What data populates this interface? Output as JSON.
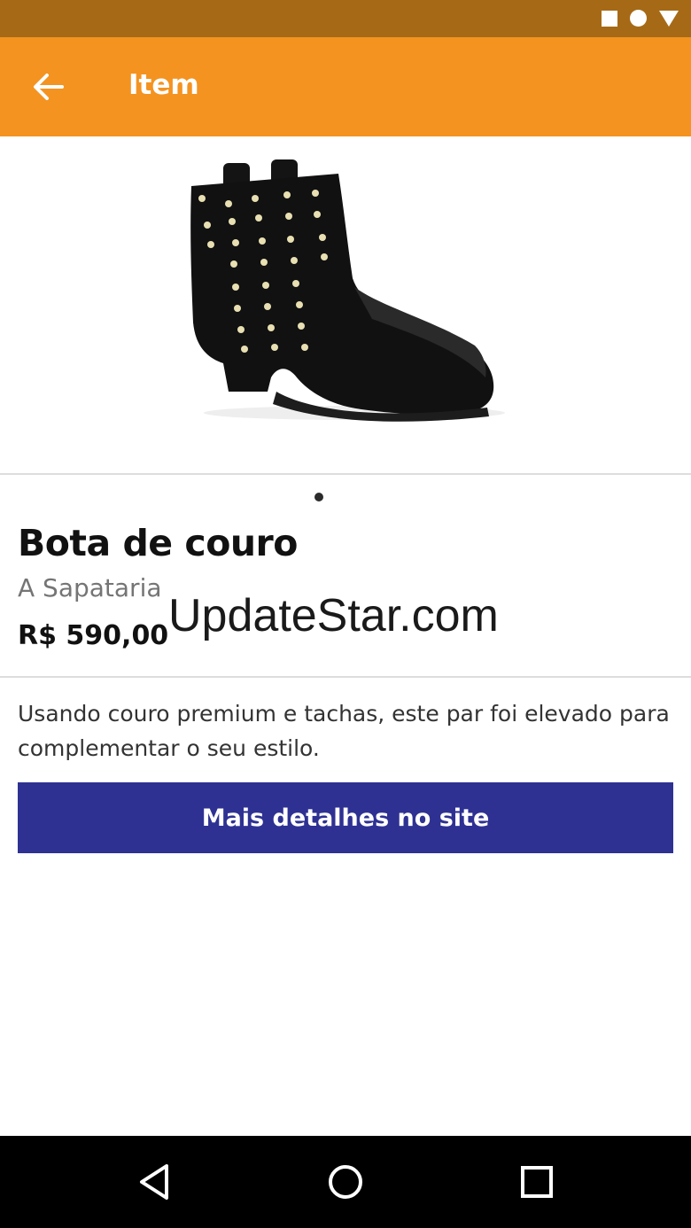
{
  "status_bar": {
    "icons": [
      "square-icon",
      "circle-icon",
      "triangle-icon"
    ]
  },
  "app_bar": {
    "back_icon": "arrow-left-icon",
    "title": "Item",
    "background": "#f49320"
  },
  "product": {
    "image_icon": "boot-image",
    "carousel_pages": 1,
    "carousel_current": 1,
    "name": "Bota de couro",
    "brand": "A Sapataria",
    "price": "R$ 590,00",
    "description": "Usando couro premium e tachas, este par foi elevado para complementar o seu estilo."
  },
  "watermark": "UpdateStar.com",
  "cta": {
    "label": "Mais detalhes no site",
    "color": "#2e3192"
  },
  "nav_bar": {
    "icons": [
      "back-triangle-icon",
      "home-circle-icon",
      "recents-square-icon"
    ]
  }
}
